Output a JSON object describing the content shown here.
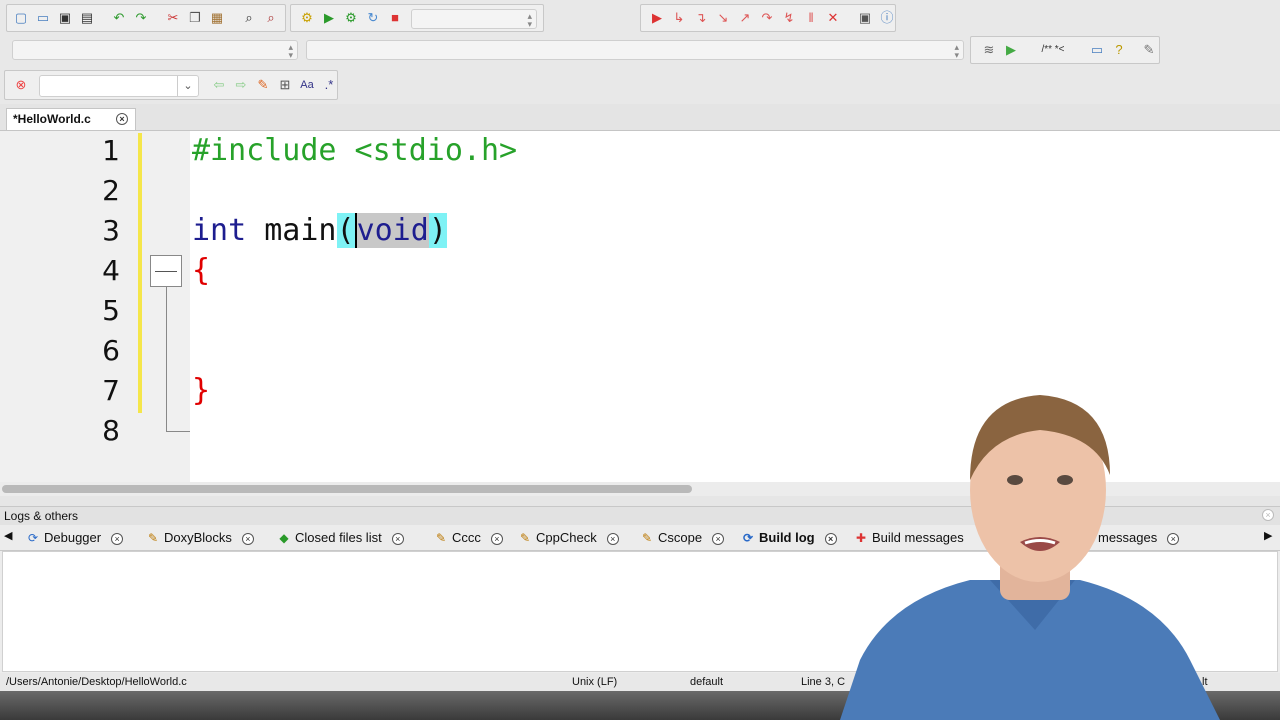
{
  "toolbar": {
    "row1_icons": [
      "new-file-icon",
      "open-icon",
      "save-icon",
      "save-all-icon",
      "undo-icon",
      "redo-icon",
      "cut-icon",
      "copy-icon",
      "paste-icon",
      "find-icon",
      "replace-icon"
    ],
    "build_icons": [
      "build-icon",
      "run-icon",
      "build-run-icon",
      "rebuild-icon",
      "abort-icon"
    ],
    "debug_icons": [
      "debug-run-icon",
      "run-to-cursor-icon",
      "next-line-icon",
      "step-into-icon",
      "step-out-icon",
      "next-instruction-icon",
      "step-into-instruction-icon",
      "break-icon",
      "stop-debugger-icon",
      "debug-windows-icon",
      "info-icon"
    ],
    "build_target": "",
    "scope_select": "",
    "function_select": "",
    "search_value": ""
  },
  "editor": {
    "tab_label": "*HelloWorld.c",
    "line_numbers": [
      "1",
      "2",
      "3",
      "4",
      "5",
      "6",
      "7",
      "8"
    ],
    "code": {
      "line1": "#include <stdio.h>",
      "line3_type": "int",
      "line3_name": " main",
      "line3_open": "(",
      "line3_param": "void",
      "line3_close": ")",
      "line4": "{",
      "line7": "}"
    },
    "colors": {
      "preprocessor": "#27a22a",
      "keyword": "#1d1d8f",
      "brace": "#e00000",
      "bracket_highlight": "#7ef2f5",
      "selection": "#c8c8c8"
    }
  },
  "logs": {
    "title": "Logs & others",
    "tabs": [
      {
        "label": "Debugger",
        "icon": "debugger-icon"
      },
      {
        "label": "DoxyBlocks",
        "icon": "doxyblocks-icon"
      },
      {
        "label": "Closed files list",
        "icon": "closed-files-icon"
      },
      {
        "label": "Cccc",
        "icon": "cccc-icon"
      },
      {
        "label": "CppCheck",
        "icon": "cppcheck-icon"
      },
      {
        "label": "Cscope",
        "icon": "cscope-icon"
      },
      {
        "label": "Build log",
        "icon": "build-log-icon"
      },
      {
        "label": "Build messages",
        "icon": "build-messages-icon"
      },
      {
        "label": "messages",
        "icon": ""
      }
    ]
  },
  "status": {
    "file_path": "/Users/Antonie/Desktop/HelloWorld.c",
    "line_ending": "Unix (LF)",
    "encoding": "default",
    "position": "Line 3, C",
    "mode": "lt"
  }
}
